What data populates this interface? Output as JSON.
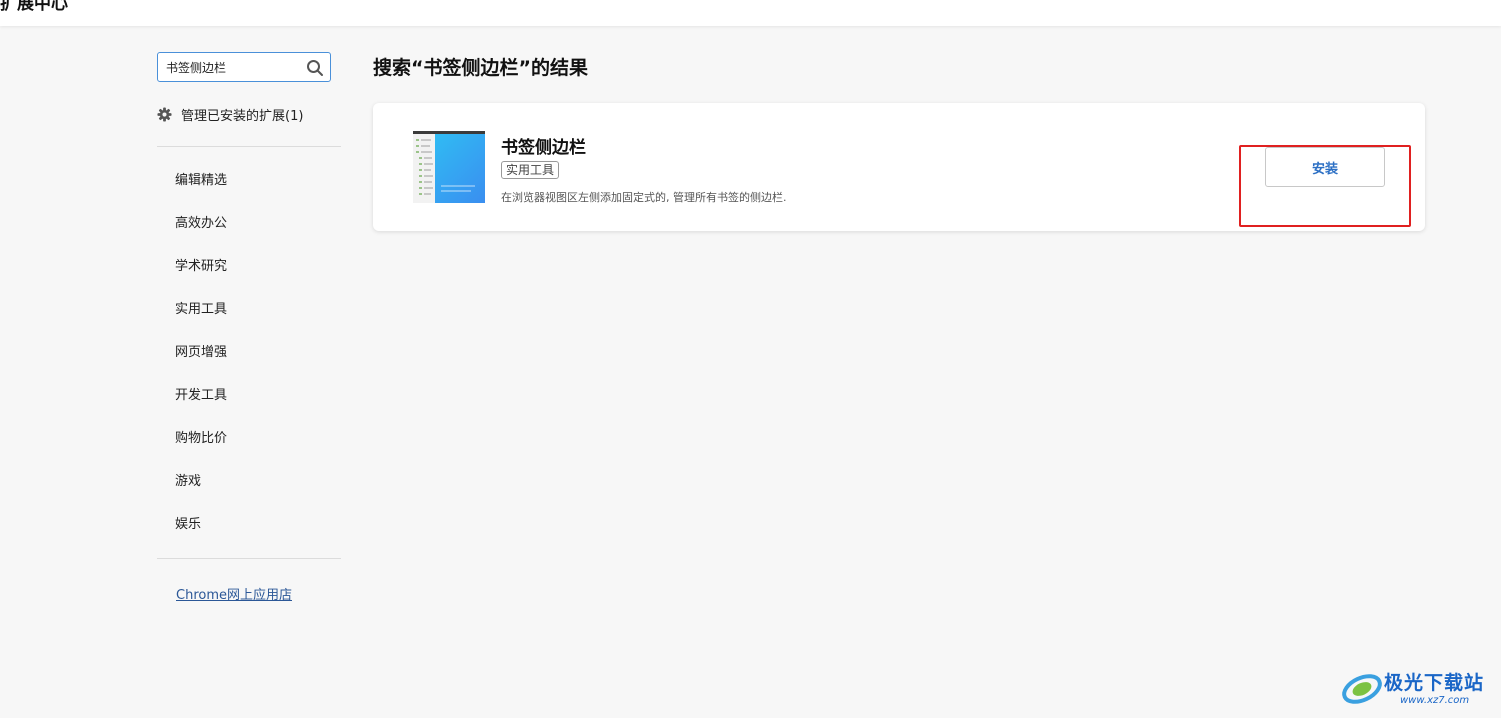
{
  "app": {
    "title": "扩展中心"
  },
  "sidebar": {
    "search": {
      "value": "书签侧边栏",
      "icon": "search-icon"
    },
    "manage": {
      "label": "管理已安装的扩展(1)",
      "icon": "gear-icon"
    },
    "categories": [
      {
        "label": "编辑精选"
      },
      {
        "label": "高效办公"
      },
      {
        "label": "学术研究"
      },
      {
        "label": "实用工具"
      },
      {
        "label": "网页增强"
      },
      {
        "label": "开发工具"
      },
      {
        "label": "购物比价"
      },
      {
        "label": "游戏"
      },
      {
        "label": "娱乐"
      }
    ],
    "store_link": "Chrome网上应用店"
  },
  "main": {
    "results_title": "搜索“书签侧边栏”的结果",
    "results": [
      {
        "name": "书签侧边栏",
        "tag": "实用工具",
        "description": "在浏览器视图区左侧添加固定式的, 管理所有书签的侧边栏.",
        "install_label": "安装"
      }
    ]
  },
  "watermark": {
    "text": "极光下载站",
    "url": "www.xz7.com"
  },
  "colors": {
    "accent": "#2b6fc4",
    "highlight": "#e02020",
    "link": "#2b5797",
    "background": "#f7f7f7"
  }
}
